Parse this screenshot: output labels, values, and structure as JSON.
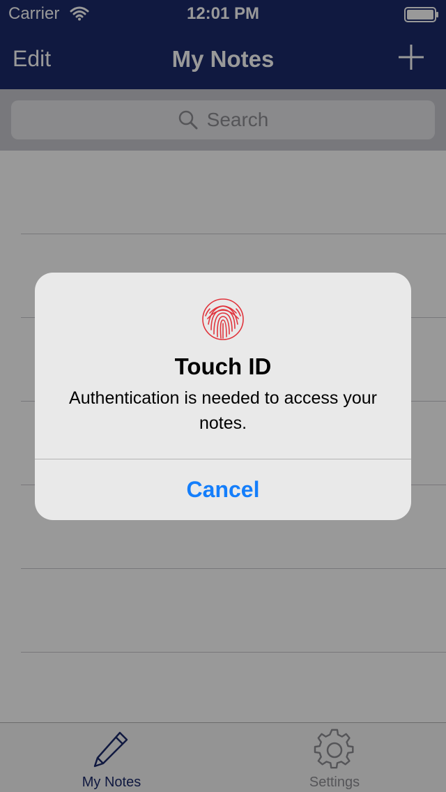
{
  "status_bar": {
    "carrier": "Carrier",
    "time": "12:01 PM",
    "wifi_icon": "wifi-icon",
    "battery_icon": "battery-icon"
  },
  "nav": {
    "edit_label": "Edit",
    "title": "My Notes",
    "add_icon": "plus-icon"
  },
  "search": {
    "placeholder": "Search",
    "icon": "search-icon"
  },
  "notes": {
    "rows": [
      "",
      "",
      "",
      "",
      "",
      ""
    ]
  },
  "tab_bar": {
    "items": [
      {
        "label": "My Notes",
        "icon": "pencil-icon",
        "selected": true
      },
      {
        "label": "Settings",
        "icon": "gear-icon",
        "selected": false
      }
    ]
  },
  "alert": {
    "icon": "fingerprint-icon",
    "title": "Touch ID",
    "message": "Authentication is needed to access your notes.",
    "cancel_label": "Cancel"
  },
  "colors": {
    "nav_background": "#1b2a6b",
    "accent": "#147efb",
    "fingerprint": "#e0343c",
    "tab_selected": "#1b2a6b",
    "tab_unselected": "#8e8e93"
  }
}
